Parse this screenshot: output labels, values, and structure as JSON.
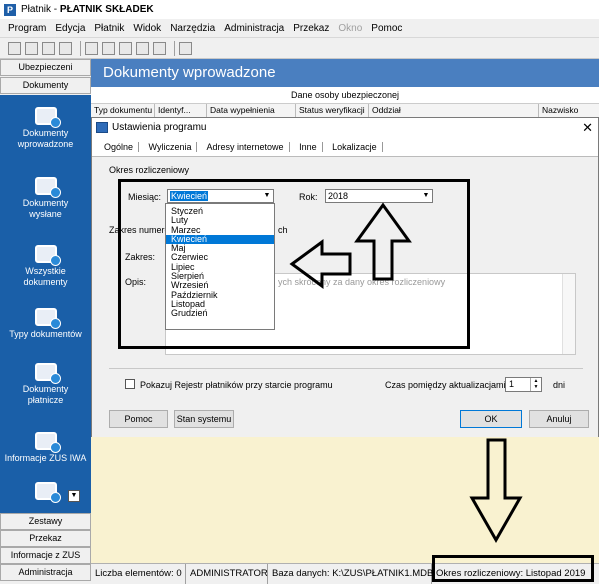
{
  "app": {
    "icon_letter": "P",
    "title_prefix": "Płatnik - ",
    "title_bold": "PŁATNIK SKŁADEK"
  },
  "menu": [
    "Program",
    "Edycja",
    "Płatnik",
    "Widok",
    "Narzędzia",
    "Administracja",
    "Przekaz",
    "Okno",
    "Pomoc"
  ],
  "menu_disabled": [
    "Okno"
  ],
  "sidebar": {
    "top_tabs": [
      "Ubezpieczeni",
      "Dokumenty"
    ],
    "items": [
      {
        "label": "Dokumenty\nwprowadzone",
        "icon": "document-inbox-icon"
      },
      {
        "label": "Dokumenty\nwysłane",
        "icon": "document-sent-icon"
      },
      {
        "label": "Wszystkie\ndokumenty",
        "icon": "all-documents-icon"
      },
      {
        "label": "Typy dokumentów",
        "icon": "document-types-icon"
      },
      {
        "label": "Dokumenty\npłatnicze",
        "icon": "payment-documents-icon"
      },
      {
        "label": "Informacje ZUS IWA",
        "icon": "iwa-icon"
      }
    ],
    "bottom_tabs": [
      "Zestawy",
      "Przekaz",
      "Informacje z ZUS",
      "Administracja"
    ]
  },
  "main": {
    "title": "Dokumenty wprowadzone",
    "group_header": "Dane osoby ubezpieczonej",
    "columns": [
      "Typ dokumentu",
      "Identyf...",
      "Data wypełnienia",
      "Status weryfikacji",
      "Oddział",
      "Nazwisko"
    ]
  },
  "dialog": {
    "title": "Ustawienia programu",
    "tabs": [
      "Ogólne",
      "Wyliczenia",
      "Adresy internetowe",
      "Inne",
      "Lokalizacje"
    ],
    "section_okres": "Okres rozliczeniowy",
    "miesiac_label": "Miesiąc:",
    "miesiac_value": "Kwiecień",
    "rok_label": "Rok:",
    "rok_value": "2018",
    "section_zakres_prefix": "Zakres numeró",
    "section_zakres_suffix": "ch",
    "zakres_label": "Zakres:",
    "opis_label": "Opis:",
    "opis_text_visible": "ych skrócony za dany okres rozliczeniowy",
    "checkbox_label": "Pokazuj Rejestr płatników przy starcie programu",
    "czas_label": "Czas pomiędzy aktualizacjami",
    "czas_value": "1",
    "czas_unit": "dni",
    "btn_pomoc": "Pomoc",
    "btn_stan": "Stan systemu",
    "btn_ok": "OK",
    "btn_anuluj": "Anuluj",
    "months": [
      "Styczeń",
      "Luty",
      "Marzec",
      "Kwiecień",
      "Maj",
      "Czerwiec",
      "Lipiec",
      "Sierpień",
      "Wrzesień",
      "Październik",
      "Listopad",
      "Grudzień"
    ],
    "selected_month": "Kwiecień"
  },
  "status": {
    "count": "Liczba elementów: 0",
    "user": "ADMINISTRATOR",
    "db": "Baza danych: K:\\ZUS\\PŁATNIK1.MDB",
    "period": "Okres rozliczeniowy: Listopad 2019"
  },
  "colors": {
    "sidebar_blue": "#1a5fa8",
    "header_blue": "#4a7fc0",
    "selection": "#0078d7"
  }
}
